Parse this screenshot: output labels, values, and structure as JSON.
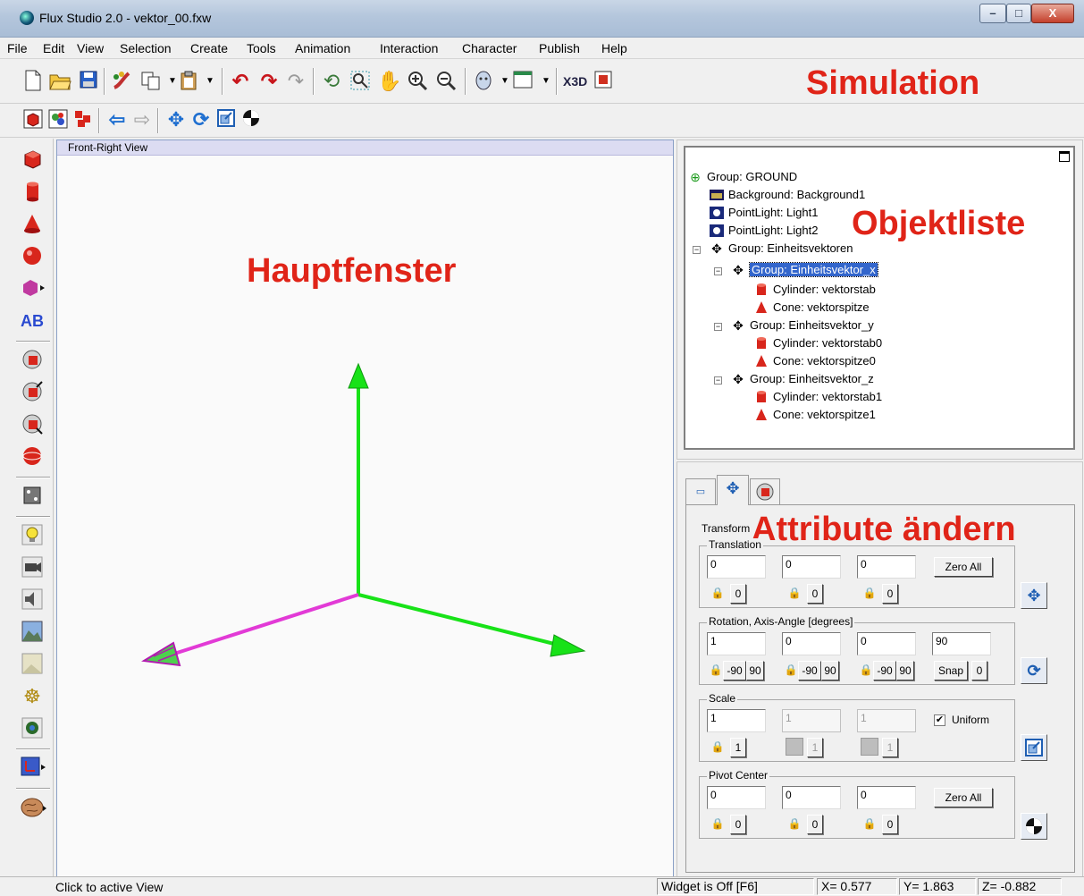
{
  "window": {
    "title": "Flux Studio 2.0 - vektor_00.fxw",
    "min_symbol": "–",
    "max_symbol": "□",
    "close_symbol": "X"
  },
  "menu": [
    "File",
    "Edit",
    "View",
    "Selection",
    "Create",
    "Tools",
    "Animation",
    "Interaction",
    "Character",
    "Publish",
    "Help"
  ],
  "toolbar": {
    "simulation_label": "Simulation",
    "row1_icons": [
      "new-file-icon",
      "open-folder-icon",
      "save-icon",
      "paint-icon",
      "copy-icon",
      "dropdown-icon",
      "paste-icon",
      "dropdown-icon",
      "undo-icon",
      "redo-icon",
      "redo-gray-icon",
      "rotate-view-icon",
      "zoom-region-icon",
      "pan-hand-icon",
      "zoom-in-icon",
      "zoom-out-icon",
      "avatar-icon",
      "dropdown-icon",
      "window-icon",
      "dropdown-icon",
      "x3d-icon",
      "package-icon"
    ],
    "row2_icons": [
      "red-box-icon",
      "multi-object-icon",
      "group-icon",
      "arrow-left-icon",
      "arrow-right-icon",
      "move-icon",
      "rotate-icon",
      "scale-icon",
      "pivot-icon"
    ]
  },
  "left_tools": [
    "box-icon",
    "cylinder-icon",
    "cone-icon",
    "sphere-icon",
    "extrusion-icon",
    "text-icon",
    "group-add-icon",
    "group-scale-icon",
    "group-resize-icon",
    "sphere-shaded-icon",
    "dice-icon",
    "lightbulb-icon",
    "camera-icon",
    "sound-icon",
    "background-icon",
    "fog-icon",
    "navigation-icon",
    "viewpoint-icon",
    "coordinate-icon",
    "brain-icon"
  ],
  "viewport": {
    "header": "Front-Right View",
    "overlay_label": "Hauptfenster",
    "colors": {
      "y_axis": "#18e218",
      "x_axis": "#18e218",
      "z_axis": "#e23ad6"
    }
  },
  "object_list": {
    "overlay_label": "Objektliste",
    "nodes": [
      {
        "label": "Group:  GROUND",
        "icon": "group-icon",
        "depth": 0
      },
      {
        "label": "Background:  Background1",
        "icon": "background-icon",
        "depth": 1
      },
      {
        "label": "PointLight:  Light1",
        "icon": "pointlight-icon",
        "depth": 1
      },
      {
        "label": "PointLight:  Light2",
        "icon": "pointlight-icon",
        "depth": 1
      },
      {
        "label": "Group:  Einheitsvektoren",
        "icon": "group-icon",
        "depth": 1
      },
      {
        "label": "Group:  Einheitsvektor_x",
        "icon": "group-icon",
        "depth": 2,
        "selected": true
      },
      {
        "label": "Cylinder:  vektorstab",
        "icon": "cylinder-icon",
        "depth": 3
      },
      {
        "label": "Cone:  vektorspitze",
        "icon": "cone-icon",
        "depth": 3
      },
      {
        "label": "Group:  Einheitsvektor_y",
        "icon": "group-icon",
        "depth": 2
      },
      {
        "label": "Cylinder:  vektorstab0",
        "icon": "cylinder-icon",
        "depth": 3
      },
      {
        "label": "Cone:  vektorspitze0",
        "icon": "cone-icon",
        "depth": 3
      },
      {
        "label": "Group:  Einheitsvektor_z",
        "icon": "group-icon",
        "depth": 2
      },
      {
        "label": "Cylinder:  vektorstab1",
        "icon": "cylinder-icon",
        "depth": 3
      },
      {
        "label": "Cone:  vektorspitze1",
        "icon": "cone-icon",
        "depth": 3
      }
    ]
  },
  "attributes": {
    "overlay_label": "Attribute ändern",
    "tabs": [
      "tag-icon",
      "move-icon",
      "material-icon"
    ],
    "transform_label": "Transform",
    "translation": {
      "label": "Translation",
      "values": [
        "0",
        "0",
        "0"
      ],
      "zero_all": "Zero All",
      "lock_values": [
        "0",
        "0",
        "0"
      ]
    },
    "rotation": {
      "label": "Rotation, Axis-Angle  [degrees]",
      "values": [
        "1",
        "0",
        "0"
      ],
      "angle": "90",
      "neg": "-90",
      "pos": "90",
      "snap": "Snap",
      "snap_value": "0"
    },
    "scale": {
      "label": "Scale",
      "values": [
        "1",
        "1",
        "1"
      ],
      "uniform": "Uniform",
      "uniform_checked": "✔",
      "lock_values": [
        "1",
        "1",
        "1"
      ]
    },
    "pivot": {
      "label": "Pivot Center",
      "values": [
        "0",
        "0",
        "0"
      ],
      "zero_all": "Zero All",
      "lock_values": [
        "0",
        "0",
        "0"
      ]
    }
  },
  "status": {
    "hint": "Click to active View",
    "widget": "Widget is Off  [F6]",
    "x": "X=  0.577",
    "y": "Y=  1.863",
    "z": "Z=  -0.882"
  }
}
